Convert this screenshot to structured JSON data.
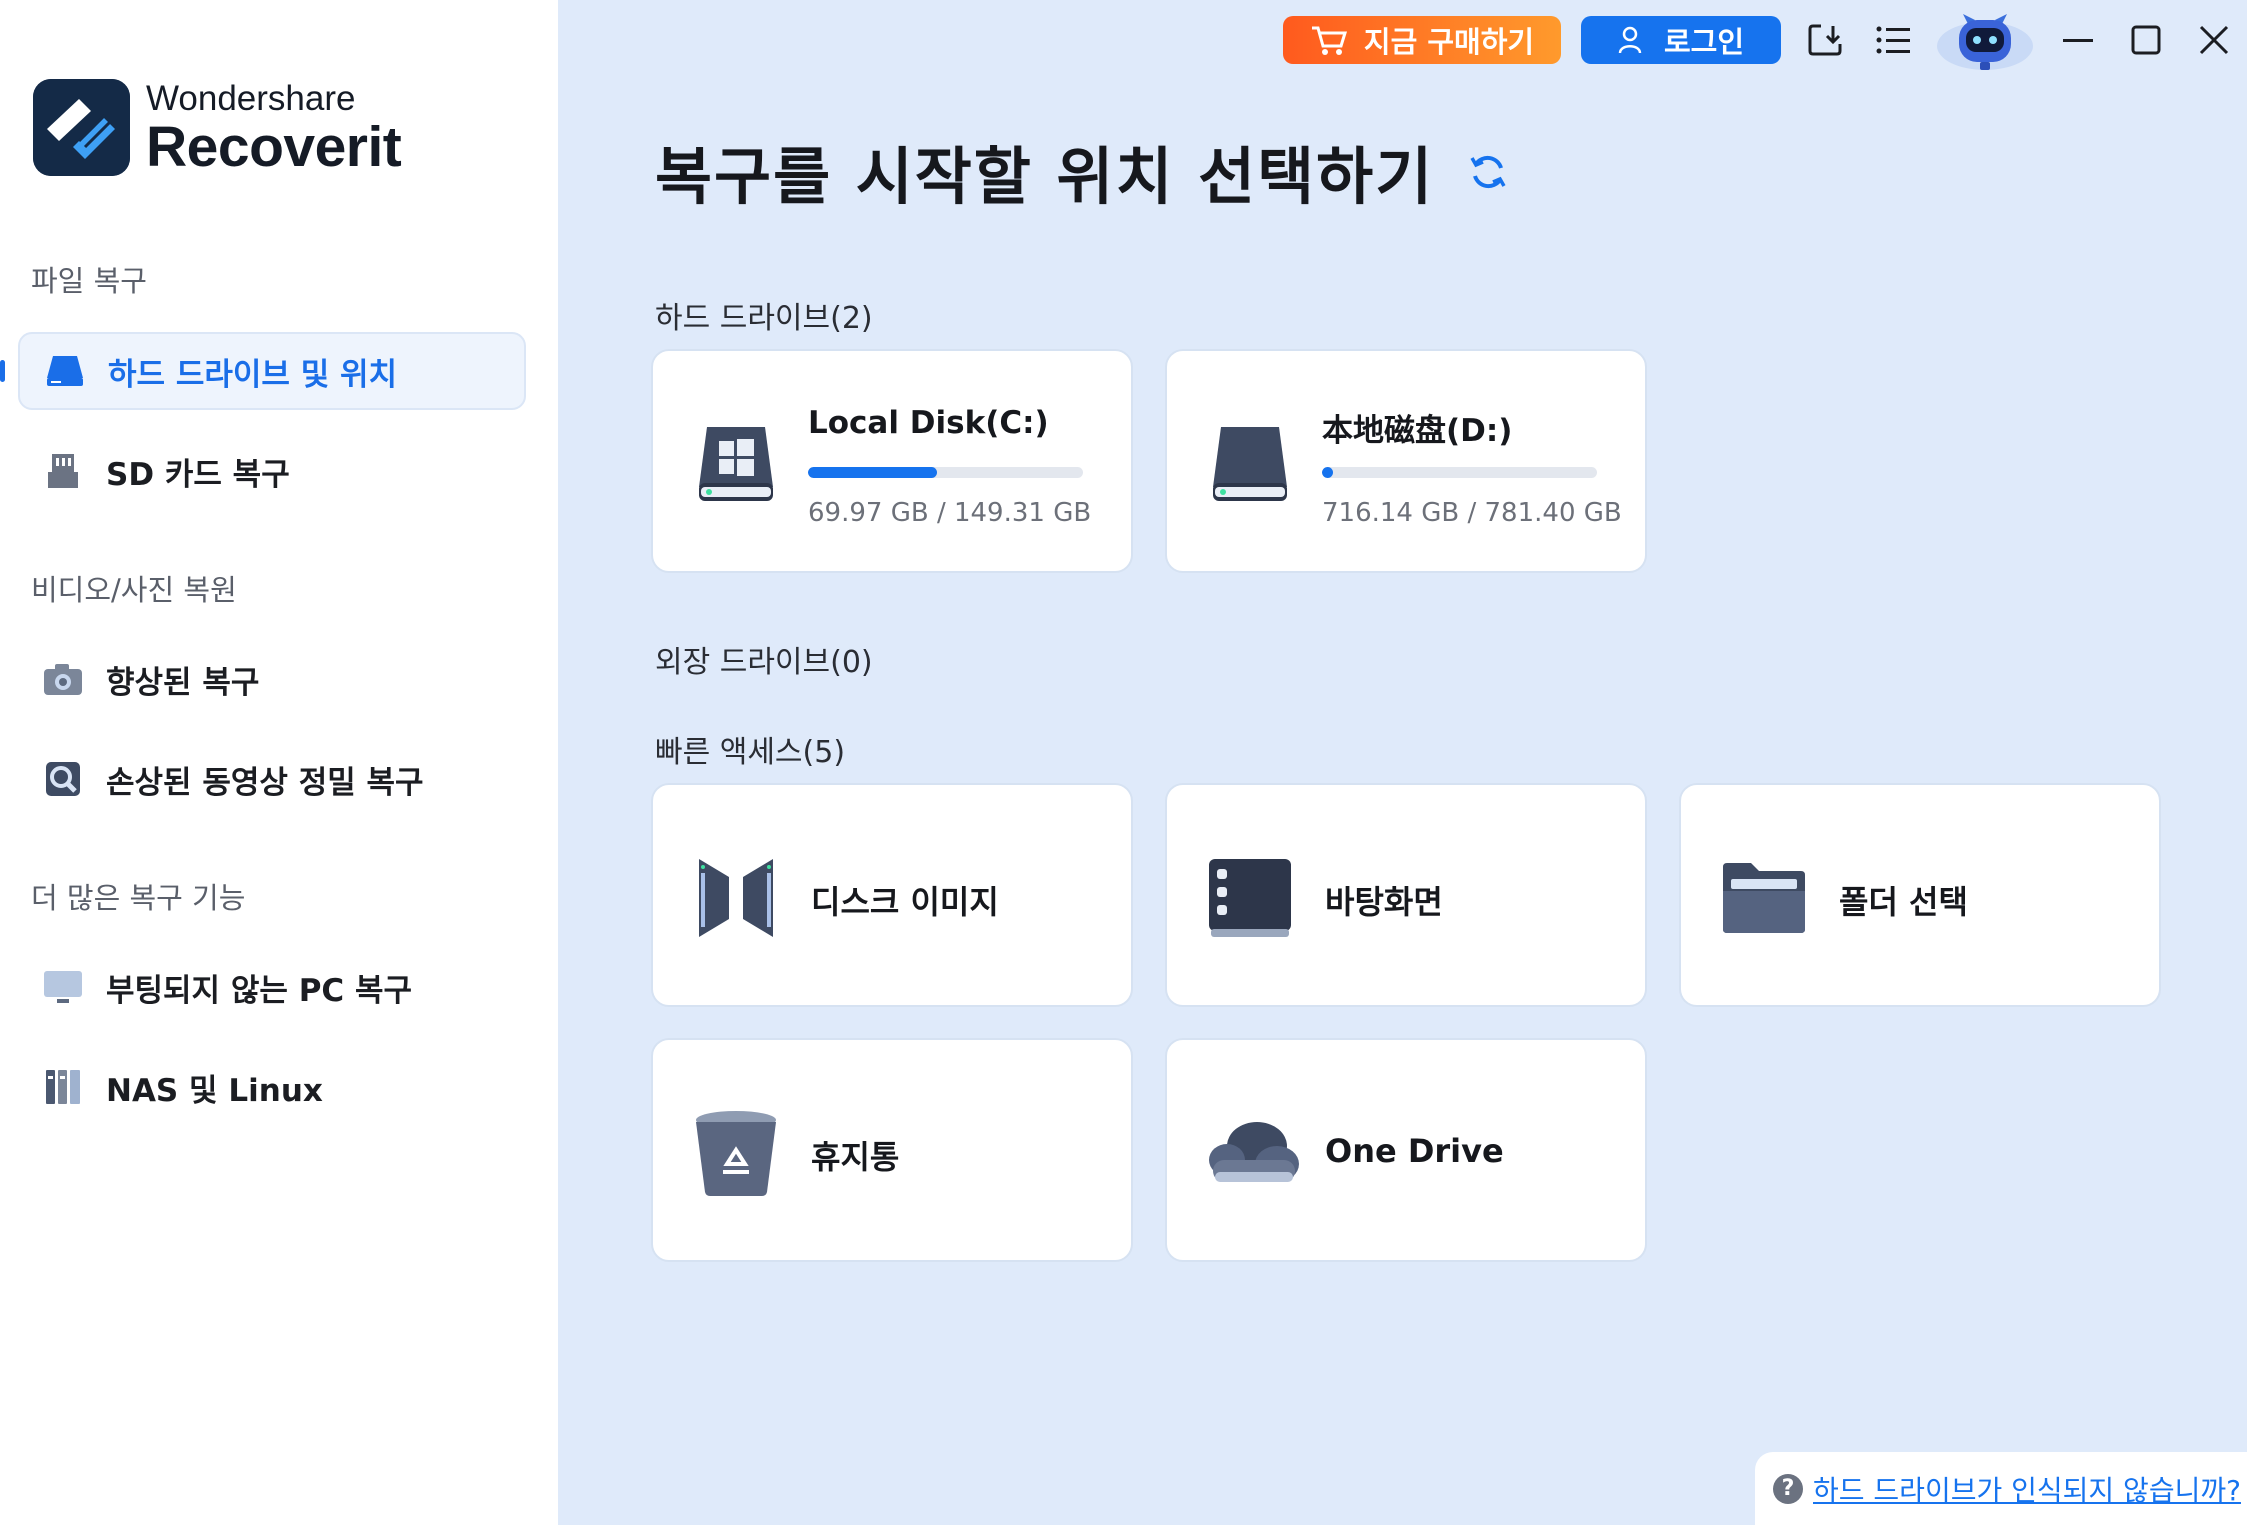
{
  "app": {
    "brand_sub": "Wondershare",
    "brand_main": "Recoverit"
  },
  "sidebar": {
    "sections": [
      {
        "title": "파일 복구",
        "items": [
          {
            "label": "하드 드라이브 및 위치",
            "icon": "hard-drive-icon",
            "active": true
          },
          {
            "label": "SD 카드 복구",
            "icon": "sd-card-icon",
            "active": false
          }
        ]
      },
      {
        "title": "비디오/사진 복원",
        "items": [
          {
            "label": "향상된 복구",
            "icon": "camera-icon",
            "active": false
          },
          {
            "label": "손상된 동영상 정밀 복구",
            "icon": "video-repair-icon",
            "active": false
          }
        ]
      },
      {
        "title": "더 많은 복구 기능",
        "items": [
          {
            "label": "부팅되지 않는 PC 복구",
            "icon": "monitor-icon",
            "active": false
          },
          {
            "label": "NAS 및 Linux",
            "icon": "nas-icon",
            "active": false
          }
        ]
      }
    ]
  },
  "topbar": {
    "buy_label": "지금 구매하기",
    "login_label": "로그인",
    "icons": [
      "import-icon",
      "menu-list-icon",
      "assistant-robot-icon",
      "minimize-icon",
      "maximize-icon",
      "close-icon"
    ]
  },
  "main": {
    "title": "복구를 시작할 위치 선택하기",
    "hard_drives": {
      "title": "하드 드라이브(2)",
      "items": [
        {
          "name": "Local Disk(C:)",
          "size": "69.97 GB / 149.31 GB",
          "used_fraction": 0.47,
          "icon": "windows-drive-icon"
        },
        {
          "name": "本地磁盘(D:)",
          "size": "716.14 GB / 781.40 GB",
          "used_fraction": 0.04,
          "icon": "drive-icon"
        }
      ]
    },
    "external_drives": {
      "title": "외장 드라이브(0)"
    },
    "quick_access": {
      "title": "빠른 액세스(5)",
      "items": [
        {
          "label": "디스크 이미지",
          "icon": "disk-image-icon"
        },
        {
          "label": "바탕화면",
          "icon": "desktop-icon"
        },
        {
          "label": "폴더 선택",
          "icon": "folder-icon"
        },
        {
          "label": "휴지통",
          "icon": "recycle-bin-icon"
        },
        {
          "label": "One Drive",
          "icon": "onedrive-icon"
        }
      ]
    },
    "help_link": "하드 드라이브가 인식되지 않습니까?"
  },
  "colors": {
    "accent": "#1673ee",
    "buy_gradient_start": "#ff5a1e",
    "buy_gradient_end": "#ff9a2c",
    "background": "#dfeafa"
  }
}
